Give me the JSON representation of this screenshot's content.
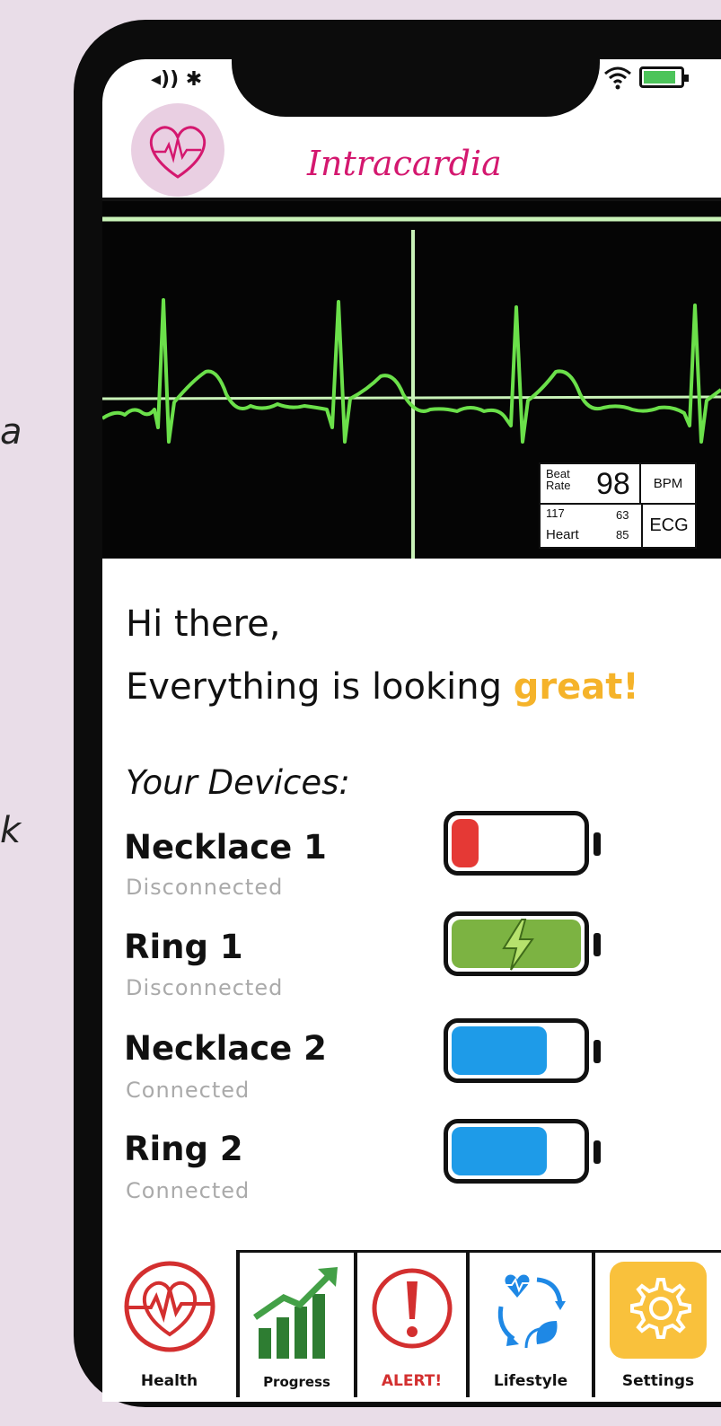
{
  "background_text": {
    "left_top": "a",
    "left_mid": "k"
  },
  "status_bar": {
    "left_icons": "◂)) ✱"
  },
  "header": {
    "app_title": "Intracardia"
  },
  "ecg": {
    "beat_rate_label": "Beat Rate",
    "bpm_value": "98",
    "bpm_unit": "BPM",
    "value_117": "117",
    "heart_label": "Heart",
    "value_63": "63",
    "value_85": "85",
    "ecg_label": "ECG"
  },
  "greeting": {
    "line1": "Hi there,",
    "line2_prefix": "Everything is looking ",
    "line2_highlight": "great!",
    "highlight_color": "#f5b32a"
  },
  "devices": {
    "heading": "Your Devices:",
    "items": [
      {
        "name": "Necklace 1",
        "status": "Disconnected",
        "battery_level": 0.2,
        "battery_color": "#e53935",
        "charging": false
      },
      {
        "name": "Ring 1",
        "status": "Disconnected",
        "battery_level": 0.95,
        "battery_color": "#7cb342",
        "charging": true
      },
      {
        "name": "Necklace 2",
        "status": "Connected",
        "battery_level": 0.7,
        "battery_color": "#1e9be8",
        "charging": false
      },
      {
        "name": "Ring 2",
        "status": "Connected",
        "battery_level": 0.7,
        "battery_color": "#1e9be8",
        "charging": false
      }
    ]
  },
  "tabs": [
    {
      "label": "Health",
      "icon": "heart-ecg-icon",
      "color": "#d32f2f"
    },
    {
      "label": "Progress",
      "icon": "growth-chart-icon",
      "color": "#2e7d32"
    },
    {
      "label": "ALERT!",
      "icon": "alert-icon",
      "color": "#d32f2f"
    },
    {
      "label": "Lifestyle",
      "icon": "lifestyle-icon",
      "color": "#1e88e5"
    },
    {
      "label": "Settings",
      "icon": "gear-icon",
      "color": "#f9c13c"
    }
  ],
  "colors": {
    "brand": "#d4186f",
    "ecg_line": "#6be04a",
    "ecg_grid": "#c9f2b8"
  }
}
